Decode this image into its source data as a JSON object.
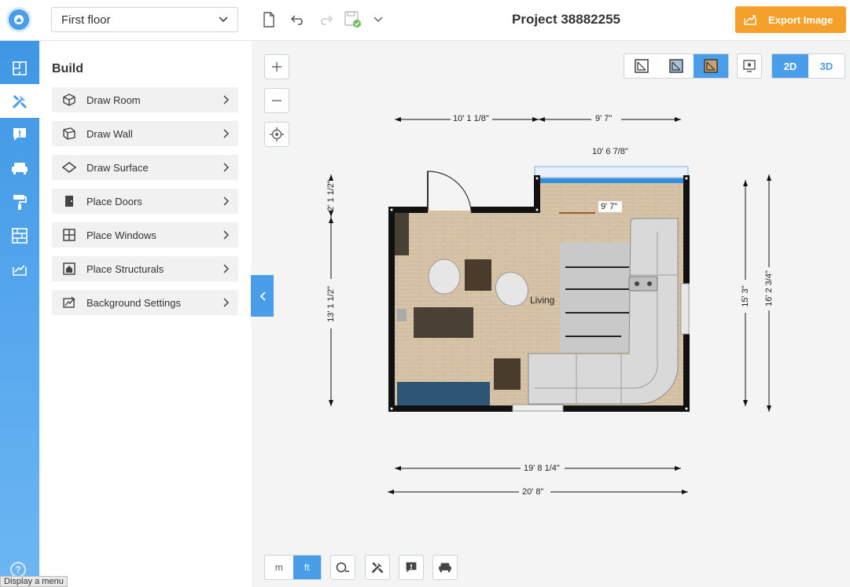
{
  "topbar": {
    "floor_selected": "First floor",
    "project_title": "Project 38882255",
    "export_label": "Export Image"
  },
  "panel": {
    "title": "Build",
    "items": [
      {
        "label": "Draw Room",
        "icon": "room-cube-icon"
      },
      {
        "label": "Draw Wall",
        "icon": "wall-icon"
      },
      {
        "label": "Draw Surface",
        "icon": "surface-diamond-icon"
      },
      {
        "label": "Place Doors",
        "icon": "door-icon"
      },
      {
        "label": "Place Windows",
        "icon": "window-icon"
      },
      {
        "label": "Place Structurals",
        "icon": "structural-icon"
      },
      {
        "label": "Background Settings",
        "icon": "background-settings-icon"
      }
    ]
  },
  "view_toggle": {
    "d2": "2D",
    "d3": "3D",
    "active": "2D"
  },
  "units": {
    "m": "m",
    "ft": "ft",
    "active": "ft"
  },
  "tooltip": "Display a menu",
  "plan": {
    "room_label": "Living",
    "dimensions": {
      "top_left": "10' 1 1/8\"",
      "top_right": "9' 7\"",
      "window_width": "10' 6 7/8\"",
      "inner_wall": "9' 7\"",
      "left_upper": "2' 1 1/2\"",
      "left_lower": "13' 1 1/2\"",
      "right_inner": "15' 3\"",
      "right_outer": "16' 2 3/4\"",
      "bottom_inner": "19' 8 1/4\"",
      "bottom_outer": "20' 8\""
    }
  },
  "colors": {
    "accent": "#4a9de8",
    "export": "#f5a02a"
  }
}
